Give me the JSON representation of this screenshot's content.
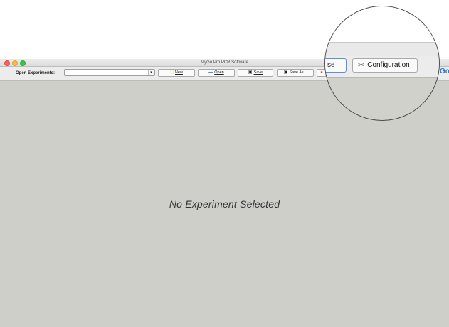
{
  "window": {
    "title": "MyGo Pro PCR Software"
  },
  "toolbar": {
    "open_experiments_label": "Open Experiments:",
    "open_experiments_value": "",
    "new_label": "New",
    "open_label": "Open",
    "save_label": "Save",
    "save_as_label": "Save As..."
  },
  "main": {
    "message": "No Experiment Selected"
  },
  "magnifier": {
    "partial_button_label": "se",
    "configuration_label": "Configuration",
    "logo_text": "Go"
  },
  "colors": {
    "accent": "#2a7fd1",
    "background": "#cfcfc9",
    "close": "#fc605b",
    "minimize": "#fdbc40",
    "zoom": "#34c84a"
  },
  "icons": [
    "new-file-icon",
    "folder-icon",
    "save-icon",
    "save-as-icon",
    "wrench-screwdriver-icon"
  ]
}
